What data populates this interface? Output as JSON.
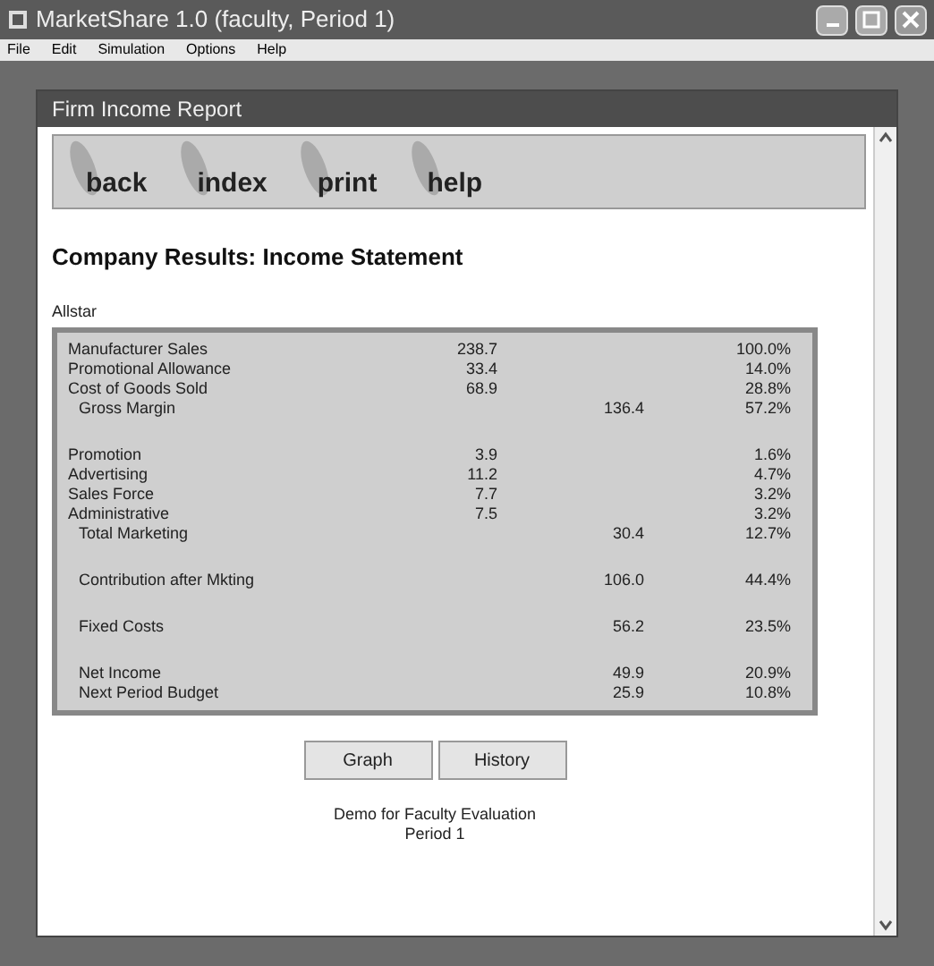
{
  "window": {
    "title": "MarketShare 1.0 (faculty, Period 1)"
  },
  "menu": [
    "File",
    "Edit",
    "Simulation",
    "Options",
    "Help"
  ],
  "report_window": {
    "title": "Firm Income Report"
  },
  "nav": [
    "back",
    "index",
    "print",
    "help"
  ],
  "heading": "Company Results: Income Statement",
  "company": "Allstar",
  "rows": [
    {
      "label": "Manufacturer Sales",
      "value": "238.7",
      "pct": "100.0%",
      "indented": false,
      "gap_before": false
    },
    {
      "label": "Promotional Allowance",
      "value": "33.4",
      "pct": "14.0%",
      "indented": false,
      "gap_before": false
    },
    {
      "label": "Cost of Goods Sold",
      "value": "68.9",
      "pct": "28.8%",
      "indented": false,
      "gap_before": false
    },
    {
      "label": "Gross Margin",
      "total": "136.4",
      "pct": "57.2%",
      "indented": true,
      "gap_before": false
    },
    {
      "label": "Promotion",
      "value": "3.9",
      "pct": "1.6%",
      "indented": false,
      "gap_before": true
    },
    {
      "label": "Advertising",
      "value": "11.2",
      "pct": "4.7%",
      "indented": false,
      "gap_before": false
    },
    {
      "label": "Sales Force",
      "value": "7.7",
      "pct": "3.2%",
      "indented": false,
      "gap_before": false
    },
    {
      "label": "Administrative",
      "value": "7.5",
      "pct": "3.2%",
      "indented": false,
      "gap_before": false
    },
    {
      "label": "Total Marketing",
      "total": "30.4",
      "pct": "12.7%",
      "indented": true,
      "gap_before": false
    },
    {
      "label": "Contribution after Mkting",
      "total": "106.0",
      "pct": "44.4%",
      "indented": true,
      "gap_before": true
    },
    {
      "label": "Fixed Costs",
      "total": "56.2",
      "pct": "23.5%",
      "indented": true,
      "gap_before": true
    },
    {
      "label": "Net Income",
      "total": "49.9",
      "pct": "20.9%",
      "indented": true,
      "gap_before": true
    },
    {
      "label": "Next Period Budget",
      "total": "25.9",
      "pct": "10.8%",
      "indented": true,
      "gap_before": false
    }
  ],
  "buttons": [
    "Graph",
    "History"
  ],
  "footer": [
    "Demo for Faculty Evaluation",
    "Period 1"
  ]
}
